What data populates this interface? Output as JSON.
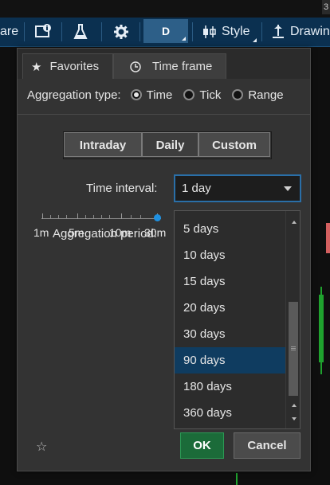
{
  "toolbar": {
    "left_label": "are",
    "timeframe_label": "D",
    "style_label": "Style",
    "drawing_label": "Drawin",
    "corner_glyph": "3"
  },
  "dialog": {
    "tabs": [
      {
        "label": "Favorites",
        "icon": "star-icon",
        "active": false
      },
      {
        "label": "Time frame",
        "icon": "clock-icon",
        "active": true
      }
    ],
    "aggregation": {
      "label": "Aggregation type:",
      "options": [
        {
          "label": "Time",
          "selected": true
        },
        {
          "label": "Tick",
          "selected": false
        },
        {
          "label": "Range",
          "selected": false
        }
      ]
    },
    "segments": [
      "Intraday",
      "Daily",
      "Custom"
    ],
    "time_interval": {
      "label": "Time interval:",
      "value": "1 day"
    },
    "aggregation_period": {
      "label": "Aggregation period:"
    },
    "slider_labels": [
      "1m",
      "5m",
      "10m",
      "30m"
    ],
    "dropdown_options": [
      "5 days",
      "10 days",
      "15 days",
      "20 days",
      "30 days",
      "90 days",
      "180 days",
      "360 days"
    ],
    "selected_option": "90 days",
    "ok_label": "OK",
    "cancel_label": "Cancel"
  },
  "colors": {
    "toolbar_bg": "#0b3050",
    "accent": "#1e90e0",
    "ok_green": "#1b6b39",
    "selection": "#0f3c60"
  }
}
